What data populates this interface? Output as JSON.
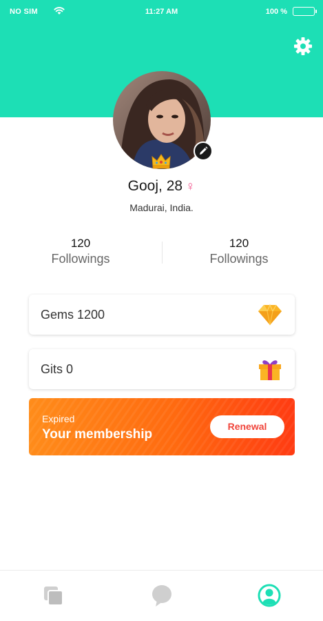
{
  "status_bar": {
    "carrier": "NO SIM",
    "time": "11:27 AM",
    "battery": "100 %"
  },
  "profile": {
    "name": "Gooj, 28",
    "gender_symbol": "♀",
    "location": "Madurai, India."
  },
  "stats": [
    {
      "value": "120",
      "label": "Followings"
    },
    {
      "value": "120",
      "label": "Followings"
    }
  ],
  "cards": {
    "gems": {
      "label": "Gems 1200",
      "icon": "diamond-icon"
    },
    "gifts": {
      "label": "Gits 0",
      "icon": "gift-icon"
    }
  },
  "membership": {
    "status": "Expired",
    "title": "Your membership",
    "button": "Renewal"
  },
  "tabbar": {
    "tabs": [
      {
        "icon": "cards-icon",
        "active": false
      },
      {
        "icon": "chat-bubble-icon",
        "active": false
      },
      {
        "icon": "profile-icon",
        "active": true
      }
    ]
  },
  "colors": {
    "brand": "#1ddfb5",
    "membership_gradient_start": "#ff8c1a",
    "membership_gradient_end": "#ff3b12",
    "gender": "#f2568e",
    "tab_inactive": "#cfcfcf",
    "tab_active": "#1ddfb5"
  }
}
